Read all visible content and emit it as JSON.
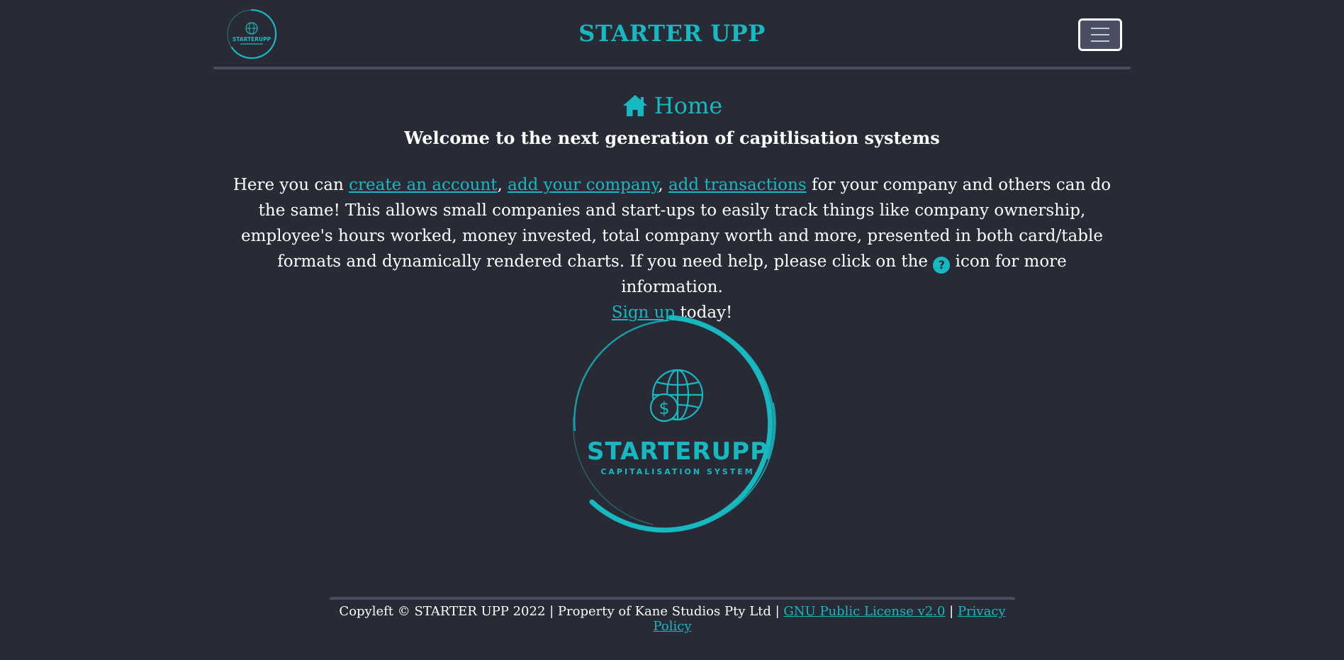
{
  "header": {
    "logo_text": "STARTERUPP",
    "brand": "STARTER UPP",
    "menu_icon": "hamburger-menu-icon"
  },
  "main": {
    "title_icon": "home-icon",
    "title": "Home",
    "subtitle": "Welcome to the next generation of capitlisation systems",
    "intro": {
      "prefix": "Here you can ",
      "link_create_account": "create an account",
      "sep1": ", ",
      "link_add_company": "add your company",
      "sep2": ", ",
      "link_add_transactions": "add transactions",
      "body": " for your company and others can do the same! This allows small companies and start-ups to easily track things like company ownership, employee's hours worked, money invested, total company worth and more, presented in both card/table formats and dynamically rendered charts. If you need help, please click on the ",
      "help_icon_glyph": "?",
      "after_icon": " icon for more information.",
      "link_sign_up": "Sign up",
      "signup_suffix": " today!"
    },
    "logo": {
      "name": "STARTERUPP",
      "tagline": "CAPITALISATION SYSTEM"
    }
  },
  "footer": {
    "text": "Copyleft © STARTER UPP 2022 | Property of Kane Studios Pty Ltd | ",
    "link_license": "GNU Public License v2.0",
    "separator": " | ",
    "link_privacy": "Privacy Policy"
  },
  "colors": {
    "background": "#282b36",
    "accent": "#17b8c0",
    "divider": "#4a4d62",
    "text": "#ffffff"
  }
}
